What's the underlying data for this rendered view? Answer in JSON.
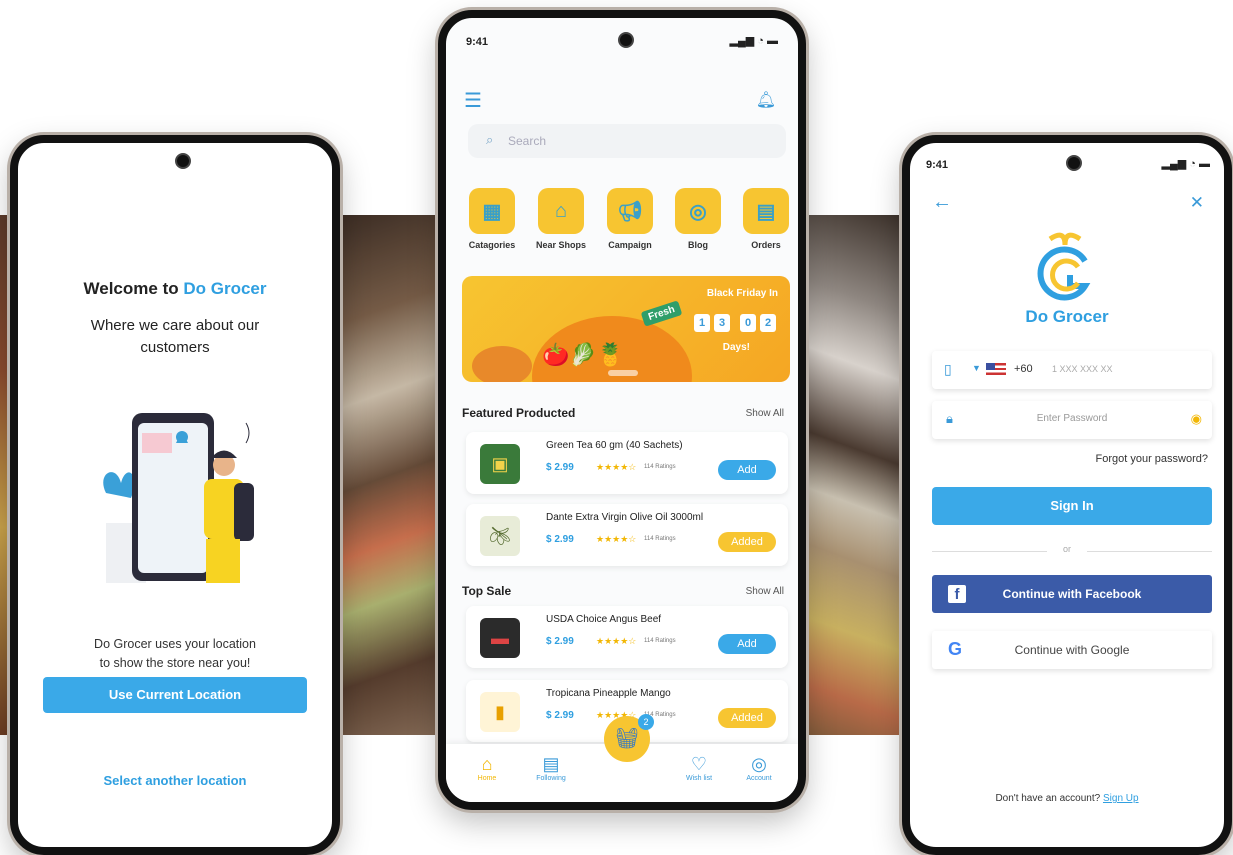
{
  "screen1": {
    "title_prefix": "Welcome to ",
    "title_brand": "Do Grocer",
    "subtitle_line1": "Where we care about our",
    "subtitle_line2": "customers",
    "desc_line1": "Do Grocer uses your location",
    "desc_line2": "to show the store near you!",
    "primary_button": "Use Current Location",
    "secondary_link": "Select another location"
  },
  "screen2": {
    "time": "9:41",
    "search_placeholder": "Search",
    "categories": [
      {
        "label": "Catagories",
        "icon": "grid-icon"
      },
      {
        "label": "Near Shops",
        "icon": "shop-icon"
      },
      {
        "label": "Campaign",
        "icon": "megaphone-icon"
      },
      {
        "label": "Blog",
        "icon": "blog-icon"
      },
      {
        "label": "Orders",
        "icon": "document-icon"
      }
    ],
    "banner": {
      "headline": "Black Friday In",
      "tag": "Fresh",
      "countdown": [
        "1",
        "3",
        "0",
        "2"
      ],
      "unit": "Days!"
    },
    "featured": {
      "heading": "Featured Producted",
      "show_all": "Show All",
      "items": [
        {
          "name": "Green Tea 60 gm (40 Sachets)",
          "price": "$ 2.99",
          "ratings": "114 Ratings",
          "button": "Add",
          "state": "add"
        },
        {
          "name": "Dante Extra Virgin Olive Oil 3000ml",
          "price": "$ 2.99",
          "ratings": "114 Ratings",
          "button": "Added",
          "state": "added"
        }
      ]
    },
    "top_sale": {
      "heading": "Top Sale",
      "show_all": "Show All",
      "items": [
        {
          "name": "USDA Choice Angus Beef",
          "price": "$ 2.99",
          "ratings": "114 Ratings",
          "button": "Add",
          "state": "add"
        },
        {
          "name": "Tropicana Pineapple Mango",
          "price": "$ 2.99",
          "ratings": "114 Ratings",
          "button": "Added",
          "state": "added"
        }
      ]
    },
    "cart_count": "2",
    "nav": [
      {
        "label": "Home",
        "icon": "home-icon"
      },
      {
        "label": "Following",
        "icon": "store-icon"
      },
      {
        "label": "Wish list",
        "icon": "heart-icon"
      },
      {
        "label": "Account",
        "icon": "account-icon"
      }
    ]
  },
  "screen3": {
    "time": "9:41",
    "brand": "Do Grocer",
    "country_code": "+60",
    "phone_placeholder": "1 XXX XXX XX",
    "password_placeholder": "Enter Password",
    "forgot": "Forgot your password?",
    "signin": "Sign In",
    "or": "or",
    "facebook": "Continue with Facebook",
    "google": "Continue with Google",
    "no_account": "Don't have an account?",
    "signup": "Sign Up"
  },
  "colors": {
    "accent_blue": "#3aa9e8",
    "accent_yellow": "#f7c531",
    "facebook_blue": "#3b5ba8"
  }
}
